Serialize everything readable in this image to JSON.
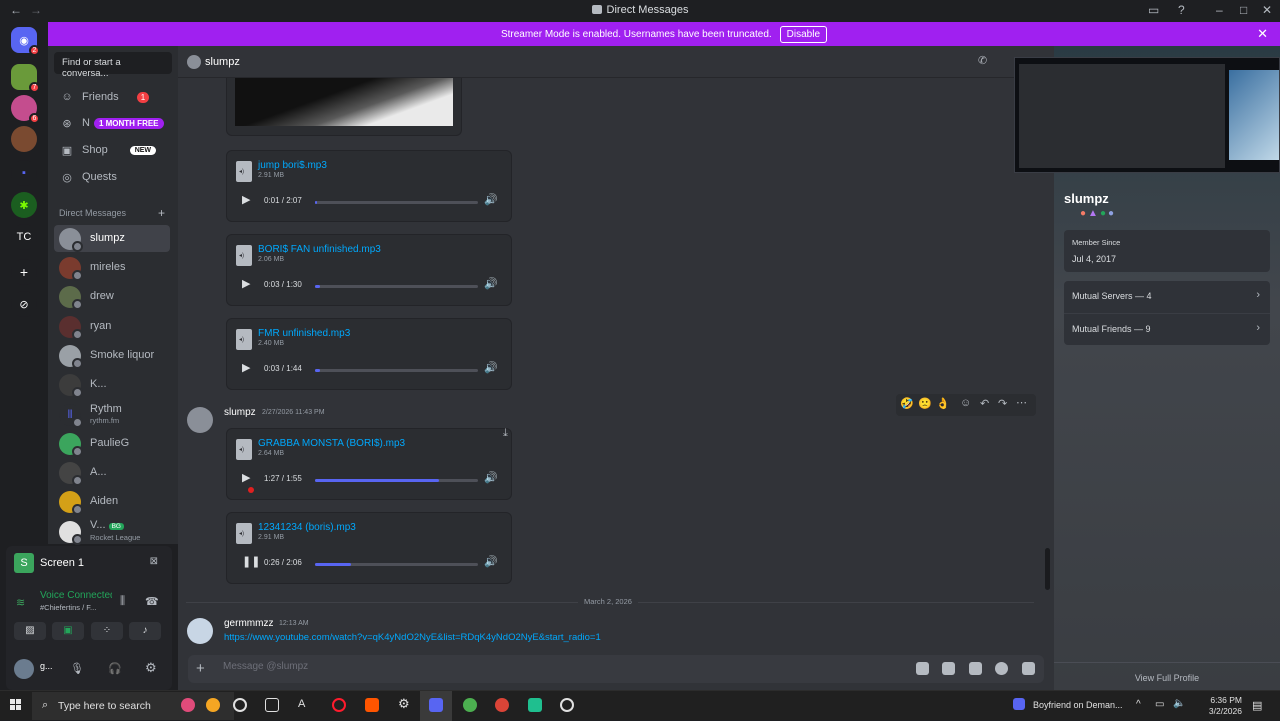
{
  "window": {
    "title": "Direct Messages"
  },
  "banner": {
    "text": "Streamer Mode is enabled. Usernames have been truncated.",
    "disable_label": "Disable"
  },
  "rail": {
    "home_badge": "2",
    "server_badges": [
      "7",
      "6"
    ],
    "tc_label": "TC"
  },
  "dm_sidebar": {
    "search_placeholder": "Find or start a conversa...",
    "nav": [
      {
        "label": "Friends",
        "badge": "1"
      },
      {
        "label": "N",
        "badge": "1 MONTH FREE"
      },
      {
        "label": "Shop",
        "badge": "NEW"
      },
      {
        "label": "Quests"
      }
    ],
    "header": "Direct Messages",
    "dms": [
      {
        "name": "slumpz",
        "selected": true
      },
      {
        "name": "mireles"
      },
      {
        "name": "drew"
      },
      {
        "name": "ryan"
      },
      {
        "name": "Smoke liquor"
      },
      {
        "name": "K..."
      },
      {
        "name": "Rythm",
        "sub": "rythm.fm"
      },
      {
        "name": "PaulieG"
      },
      {
        "name": "A..."
      },
      {
        "name": "Aiden"
      },
      {
        "name": "V...",
        "tag": "BG",
        "sub": "Rocket League"
      }
    ]
  },
  "voice": {
    "screen_label": "Screen 1",
    "status": "Voice Connected",
    "channel": "#Chiefertins / F...",
    "user_short": "g..."
  },
  "chat": {
    "header_name": "slumpz",
    "attachments_top": [
      {
        "name": "jump bori$.mp3",
        "size": "2.91 MB",
        "time": "0:01 / 2:07",
        "progress": 0.01
      },
      {
        "name": "BORI$ FAN unfinished.mp3",
        "size": "2.06 MB",
        "time": "0:03 / 1:30",
        "progress": 0.03
      },
      {
        "name": "FMR unfinished.mp3",
        "size": "2.40 MB",
        "time": "0:03 / 1:44",
        "progress": 0.03
      }
    ],
    "message2": {
      "author": "slumpz",
      "timestamp": "2/27/2026 11:43 PM",
      "attachments": [
        {
          "name": "GRABBA MONSTA (BORI$).mp3",
          "size": "2.64 MB",
          "time": "1:27 / 1:55",
          "progress": 0.76,
          "state": "paused"
        },
        {
          "name": "12341234 (boris).mp3",
          "size": "2.91 MB",
          "time": "0:26 / 2:06",
          "progress": 0.22,
          "state": "playing"
        }
      ]
    },
    "date_divider": "March 2, 2026",
    "message3": {
      "author": "germmmzz",
      "timestamp": "12:13 AM",
      "link": "https://www.youtube.com/watch?v=qK4yNdO2NyE&list=RDqK4yNdO2NyE&start_radio=1"
    },
    "composer_placeholder": "Message @slumpz"
  },
  "profile": {
    "name": "slumpz",
    "member_since_label": "Member Since",
    "member_since": "Jul 4, 2017",
    "mutual_servers": "Mutual Servers — 4",
    "mutual_friends": "Mutual Friends — 9",
    "view_full": "View Full Profile"
  },
  "taskbar": {
    "search_placeholder": "Type here to search",
    "now_playing": "Boyfriend on Deman...",
    "time": "6:36 PM",
    "date": "3/2/2026"
  },
  "colors": {
    "accent": "#5865f2",
    "banner": "#a020f0",
    "link": "#00a8fc",
    "bg": "#313338"
  }
}
